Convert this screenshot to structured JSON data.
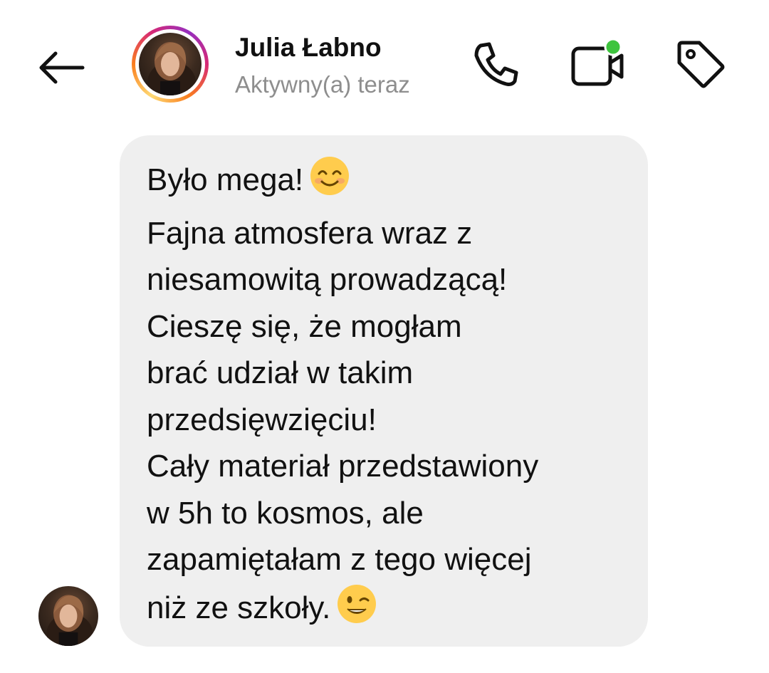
{
  "header": {
    "contact_name": "Julia Łabno",
    "status": "Aktywny(a) teraz",
    "icons": [
      "back-arrow-icon",
      "phone-icon",
      "video-call-icon",
      "tag-icon"
    ],
    "online_indicator_color": "#3ec43e",
    "story_ring_colors": [
      "#feda75",
      "#fa7e1e",
      "#d62976",
      "#962fbf"
    ]
  },
  "message": {
    "bubble_color": "#efefef",
    "lines": [
      "Było mega!",
      "Fajna atmosfera wraz z",
      "niesamowitą prowadzącą!",
      "Cieszę się, że mogłam",
      "brać udział w takim",
      "przedsięwzięciu!",
      "Cały materiał przedstawiony",
      "w 5h to kosmos, ale",
      "zapamiętałam z tego więcej",
      "niż ze szkoły."
    ],
    "emojis": [
      "smiling-face-emoji",
      "winking-face-emoji"
    ]
  }
}
